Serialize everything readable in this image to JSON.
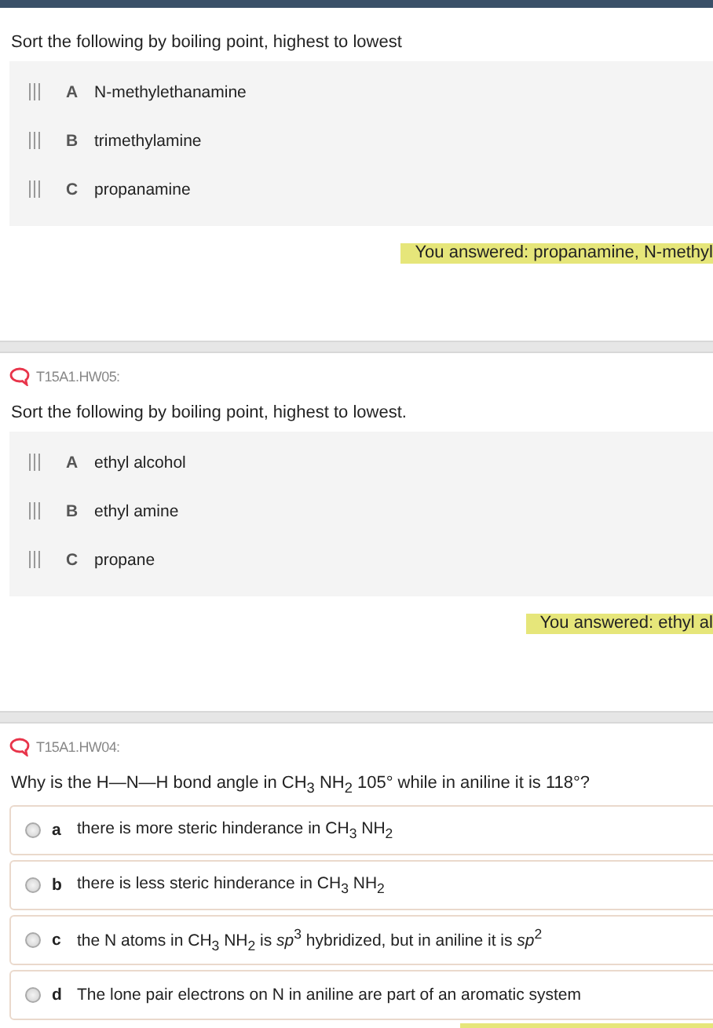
{
  "questions": [
    {
      "kind": "sort",
      "prompt": "Sort the following by boiling point, highest to lowest",
      "options": [
        {
          "letter": "A",
          "text": "N-methylethanamine"
        },
        {
          "letter": "B",
          "text": "trimethylamine"
        },
        {
          "letter": "C",
          "text": "propanamine"
        }
      ],
      "answer": "You answered: propanamine, N-methyl"
    },
    {
      "id": "T15A1.HW05:",
      "kind": "sort",
      "prompt": "Sort the following by boiling point, highest to lowest.",
      "options": [
        {
          "letter": "A",
          "text": "ethyl alcohol"
        },
        {
          "letter": "B",
          "text": "ethyl amine"
        },
        {
          "letter": "C",
          "text": "propane"
        }
      ],
      "answer": "You answered: ethyl al"
    },
    {
      "id": "T15A1.HW04:",
      "kind": "choice",
      "prompt": "Why is the H—N—H bond angle in CH$_{3}$ NH$_{2}$  105° while in aniline it is 118°?",
      "options": [
        {
          "letter": "a",
          "text": "there is more steric hinderance in CH$_{3}$ NH$_{2}$",
          "selected": false
        },
        {
          "letter": "b",
          "text": "there is less steric hinderance in CH$_{3}$ NH$_{2}$",
          "selected": false
        },
        {
          "letter": "c",
          "text": "the N atoms in CH$_{3}$ NH$_{2}$  is *sp*$^{3}$ hybridized, but in aniline it is *sp*$^{2}$",
          "selected": false
        },
        {
          "letter": "d",
          "text": "The lone pair electrons on N in aniline are part of an aromatic system",
          "selected": false
        }
      ]
    }
  ]
}
